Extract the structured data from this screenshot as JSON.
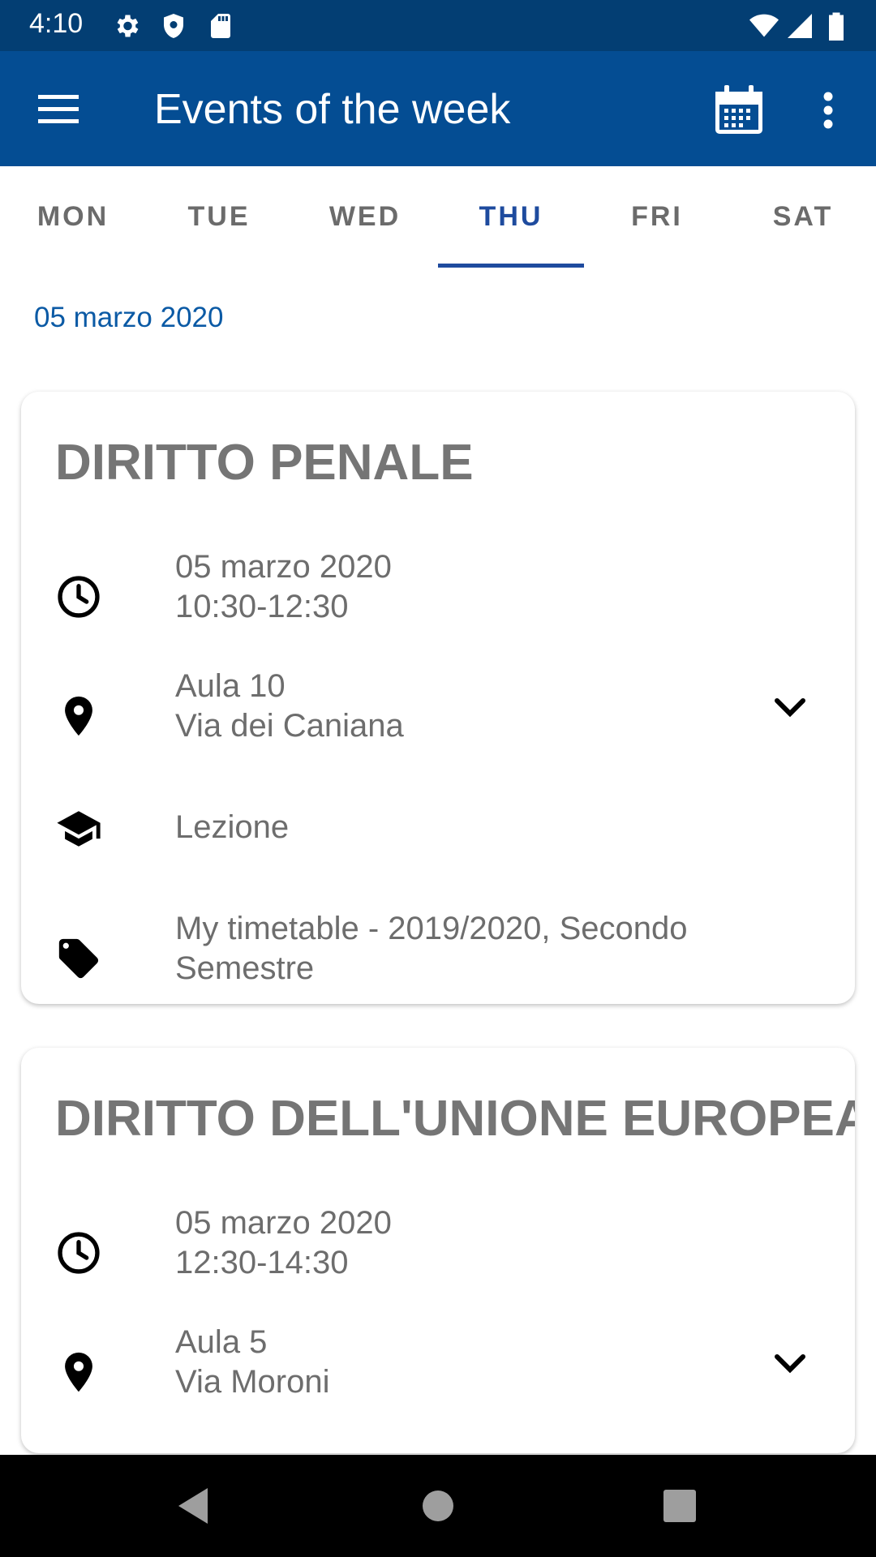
{
  "status_bar": {
    "time": "4:10",
    "icons": [
      "gear-icon",
      "shield-icon",
      "sd-card-icon",
      "wifi-icon",
      "signal-icon",
      "battery-icon"
    ]
  },
  "app_bar": {
    "title": "Events of the week",
    "color": "#044d93",
    "icons": [
      "menu-icon",
      "calendar-icon",
      "more-vert-icon"
    ]
  },
  "tabs": [
    {
      "label": "MON",
      "active": false
    },
    {
      "label": "TUE",
      "active": false
    },
    {
      "label": "WED",
      "active": false
    },
    {
      "label": "THU",
      "active": true
    },
    {
      "label": "FRI",
      "active": false
    },
    {
      "label": "SAT",
      "active": false
    }
  ],
  "accent_color": "#1e4b9e",
  "date_heading": "05 marzo 2020",
  "events": [
    {
      "title": "DIRITTO PENALE",
      "date": "05 marzo 2020",
      "time": "10:30-12:30",
      "room": "Aula 10",
      "address": "Via dei Caniana",
      "type": "Lezione",
      "tag_line1": "My timetable - 2019/2020, Secondo",
      "tag_line2": "Semestre"
    },
    {
      "title": "DIRITTO DELL'UNIONE EUROPEA",
      "date": "05 marzo 2020",
      "time": "12:30-14:30",
      "room": "Aula 5",
      "address": "Via Moroni"
    }
  ],
  "nav_bar": {
    "icons": [
      "back-icon",
      "home-icon",
      "recents-icon"
    ]
  }
}
